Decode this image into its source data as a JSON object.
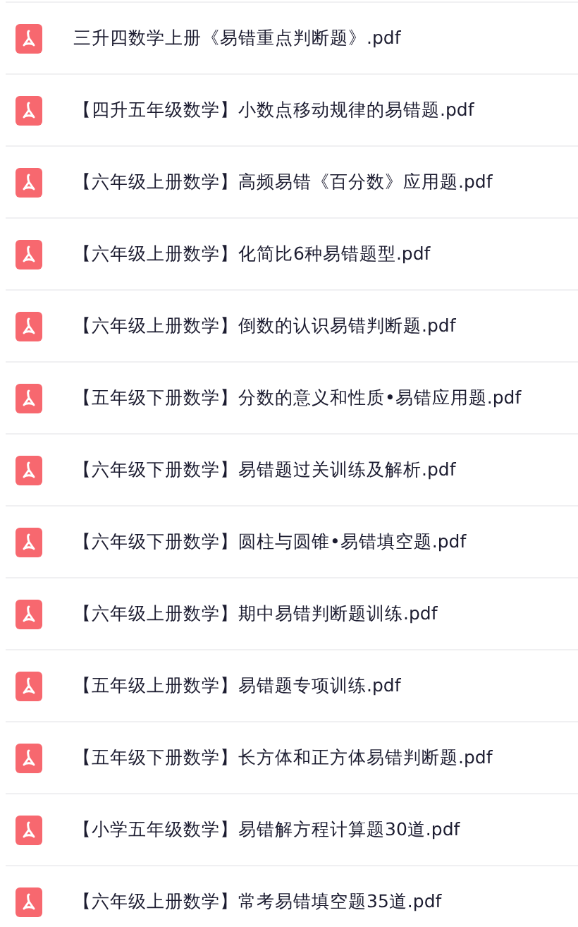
{
  "files": [
    {
      "name": "三升四数学上册《易错重点判断题》.pdf"
    },
    {
      "name": "【四升五年级数学】小数点移动规律的易错题.pdf"
    },
    {
      "name": "【六年级上册数学】高频易错《百分数》应用题.pdf"
    },
    {
      "name": "【六年级上册数学】化简比6种易错题型.pdf"
    },
    {
      "name": "【六年级上册数学】倒数的认识易错判断题.pdf"
    },
    {
      "name": "【五年级下册数学】分数的意义和性质•易错应用题.pdf"
    },
    {
      "name": "【六年级下册数学】易错题过关训练及解析.pdf"
    },
    {
      "name": "【六年级下册数学】圆柱与圆锥•易错填空题.pdf"
    },
    {
      "name": "【六年级上册数学】期中易错判断题训练.pdf"
    },
    {
      "name": "【五年级上册数学】易错题专项训练.pdf"
    },
    {
      "name": "【五年级下册数学】长方体和正方体易错判断题.pdf"
    },
    {
      "name": "【小学五年级数学】易错解方程计算题30道.pdf"
    },
    {
      "name": "【六年级上册数学】常考易错填空题35道.pdf"
    }
  ]
}
